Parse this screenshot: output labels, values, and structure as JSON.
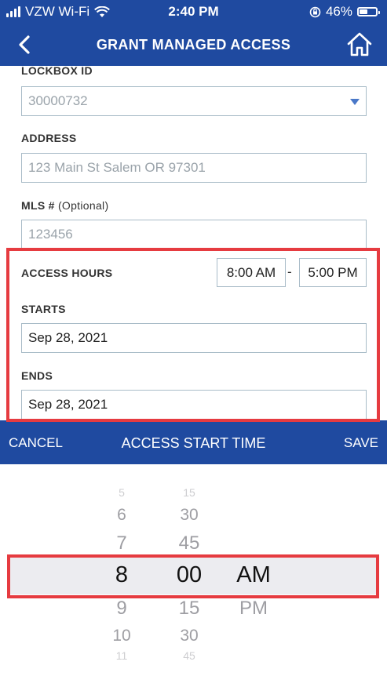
{
  "status_bar": {
    "carrier": "VZW Wi-Fi",
    "time": "2:40 PM",
    "battery": "46%",
    "battery_level": 0.46
  },
  "nav": {
    "title": "GRANT MANAGED ACCESS",
    "back_icon": "chevron-left-icon",
    "home_icon": "home-icon"
  },
  "form": {
    "lockbox_label": "LOCKBOX ID",
    "lockbox_value": "30000732",
    "address_label": "ADDRESS",
    "address_placeholder": "123 Main St  Salem OR 97301",
    "mls_label": "MLS #",
    "mls_optional": "(Optional)",
    "mls_placeholder": "123456",
    "access_hours_label": "ACCESS HOURS",
    "start_time": "8:00 AM",
    "separator": "-",
    "end_time": "5:00 PM",
    "starts_label": "STARTS",
    "starts_value": "Sep 28, 2021",
    "ends_label": "ENDS",
    "ends_value": "Sep 28, 2021"
  },
  "picker_bar": {
    "cancel": "CANCEL",
    "title": "ACCESS START TIME",
    "save": "SAVE"
  },
  "picker": {
    "hours": [
      "5",
      "6",
      "7",
      "8",
      "9",
      "10",
      "11"
    ],
    "minutes": [
      "15",
      "30",
      "45",
      "00",
      "15",
      "30",
      "45"
    ],
    "periods": [
      "AM",
      "PM"
    ],
    "selected": {
      "hour": "8",
      "minute": "00",
      "period": "AM"
    }
  },
  "colors": {
    "brand_blue": "#1f4aa0",
    "highlight_red": "#e63b40"
  }
}
